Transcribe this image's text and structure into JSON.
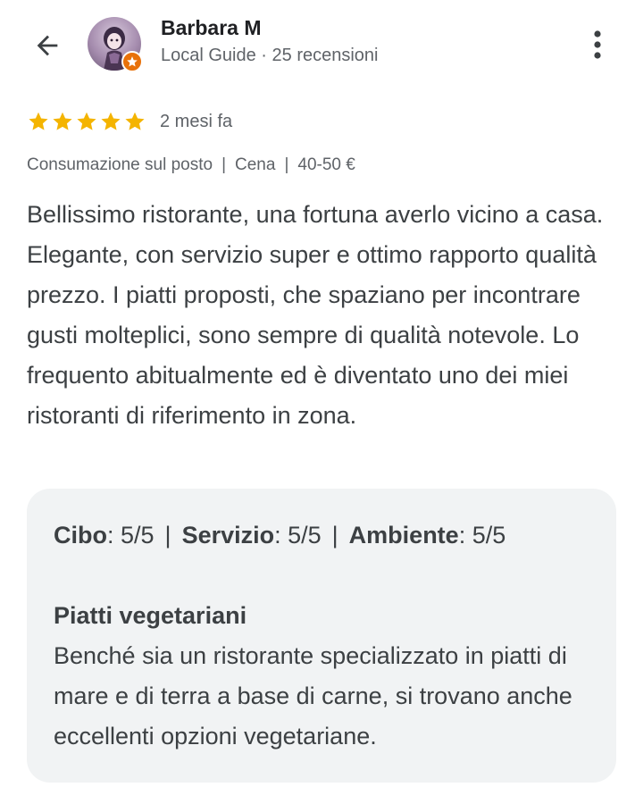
{
  "header": {
    "user_name": "Barbara M",
    "user_meta": "Local Guide · 25 recensioni",
    "back_icon": "arrow-back-icon",
    "more_icon": "more-vert-icon",
    "badge_icon": "star-badge-icon"
  },
  "rating": {
    "stars": 5,
    "max_stars": 5,
    "time_ago": "2 mesi fa",
    "star_color": "#f4b400"
  },
  "visit": {
    "service_type": "Consumazione sul posto",
    "meal_type": "Cena",
    "price_range": "40-50 €",
    "separator": "|"
  },
  "review": {
    "text": "Bellissimo ristorante, una fortuna averlo vicino a casa. Elegante, con servizio super e ottimo rapporto qualità prezzo. I piatti proposti, che spaziano per incontrare gusti molteplici, sono sempre di qualità notevole. Lo frequento abitualmente ed è diventato uno dei miei ristoranti di riferimento in zona."
  },
  "attributes": {
    "food_label": "Cibo",
    "food_value": ": 5/5",
    "service_label": "Servizio",
    "service_value": ": 5/5",
    "ambience_label": "Ambiente",
    "ambience_value": ": 5/5",
    "separator": "|",
    "vegetarian_title": "Piatti vegetariani",
    "vegetarian_text": "Benché sia un ristorante specializzato in piatti di mare e di terra a base di carne, si trovano anche eccellenti opzioni vegetariane."
  },
  "colors": {
    "accent_orange": "#e8710a",
    "text_primary": "#202124",
    "text_secondary": "#5f6368",
    "box_background": "#f1f3f4"
  }
}
